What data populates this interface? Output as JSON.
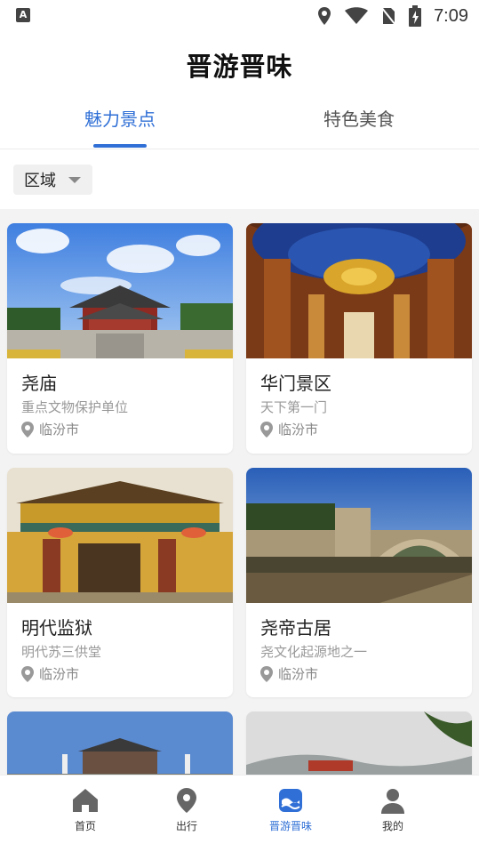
{
  "status_bar": {
    "time": "7:09"
  },
  "header": {
    "title": "晋游晋味"
  },
  "tabs": [
    {
      "label": "魅力景点",
      "active": true
    },
    {
      "label": "特色美食",
      "active": false
    }
  ],
  "filter": {
    "region_label": "区域"
  },
  "cards": [
    {
      "name": "尧庙",
      "subtitle": "重点文物保护单位",
      "location": "临汾市"
    },
    {
      "name": "华门景区",
      "subtitle": "天下第一门",
      "location": "临汾市"
    },
    {
      "name": "明代监狱",
      "subtitle": "明代苏三供堂",
      "location": "临汾市"
    },
    {
      "name": "尧帝古居",
      "subtitle": "尧文化起源地之一",
      "location": "临汾市"
    }
  ],
  "bottom_nav": [
    {
      "label": "首页",
      "icon": "home-icon",
      "active": false
    },
    {
      "label": "出行",
      "icon": "location-icon",
      "active": false
    },
    {
      "label": "晋游晋味",
      "icon": "travel-icon",
      "active": true
    },
    {
      "label": "我的",
      "icon": "user-icon",
      "active": false
    }
  ],
  "colors": {
    "accent": "#2f6fd6"
  }
}
